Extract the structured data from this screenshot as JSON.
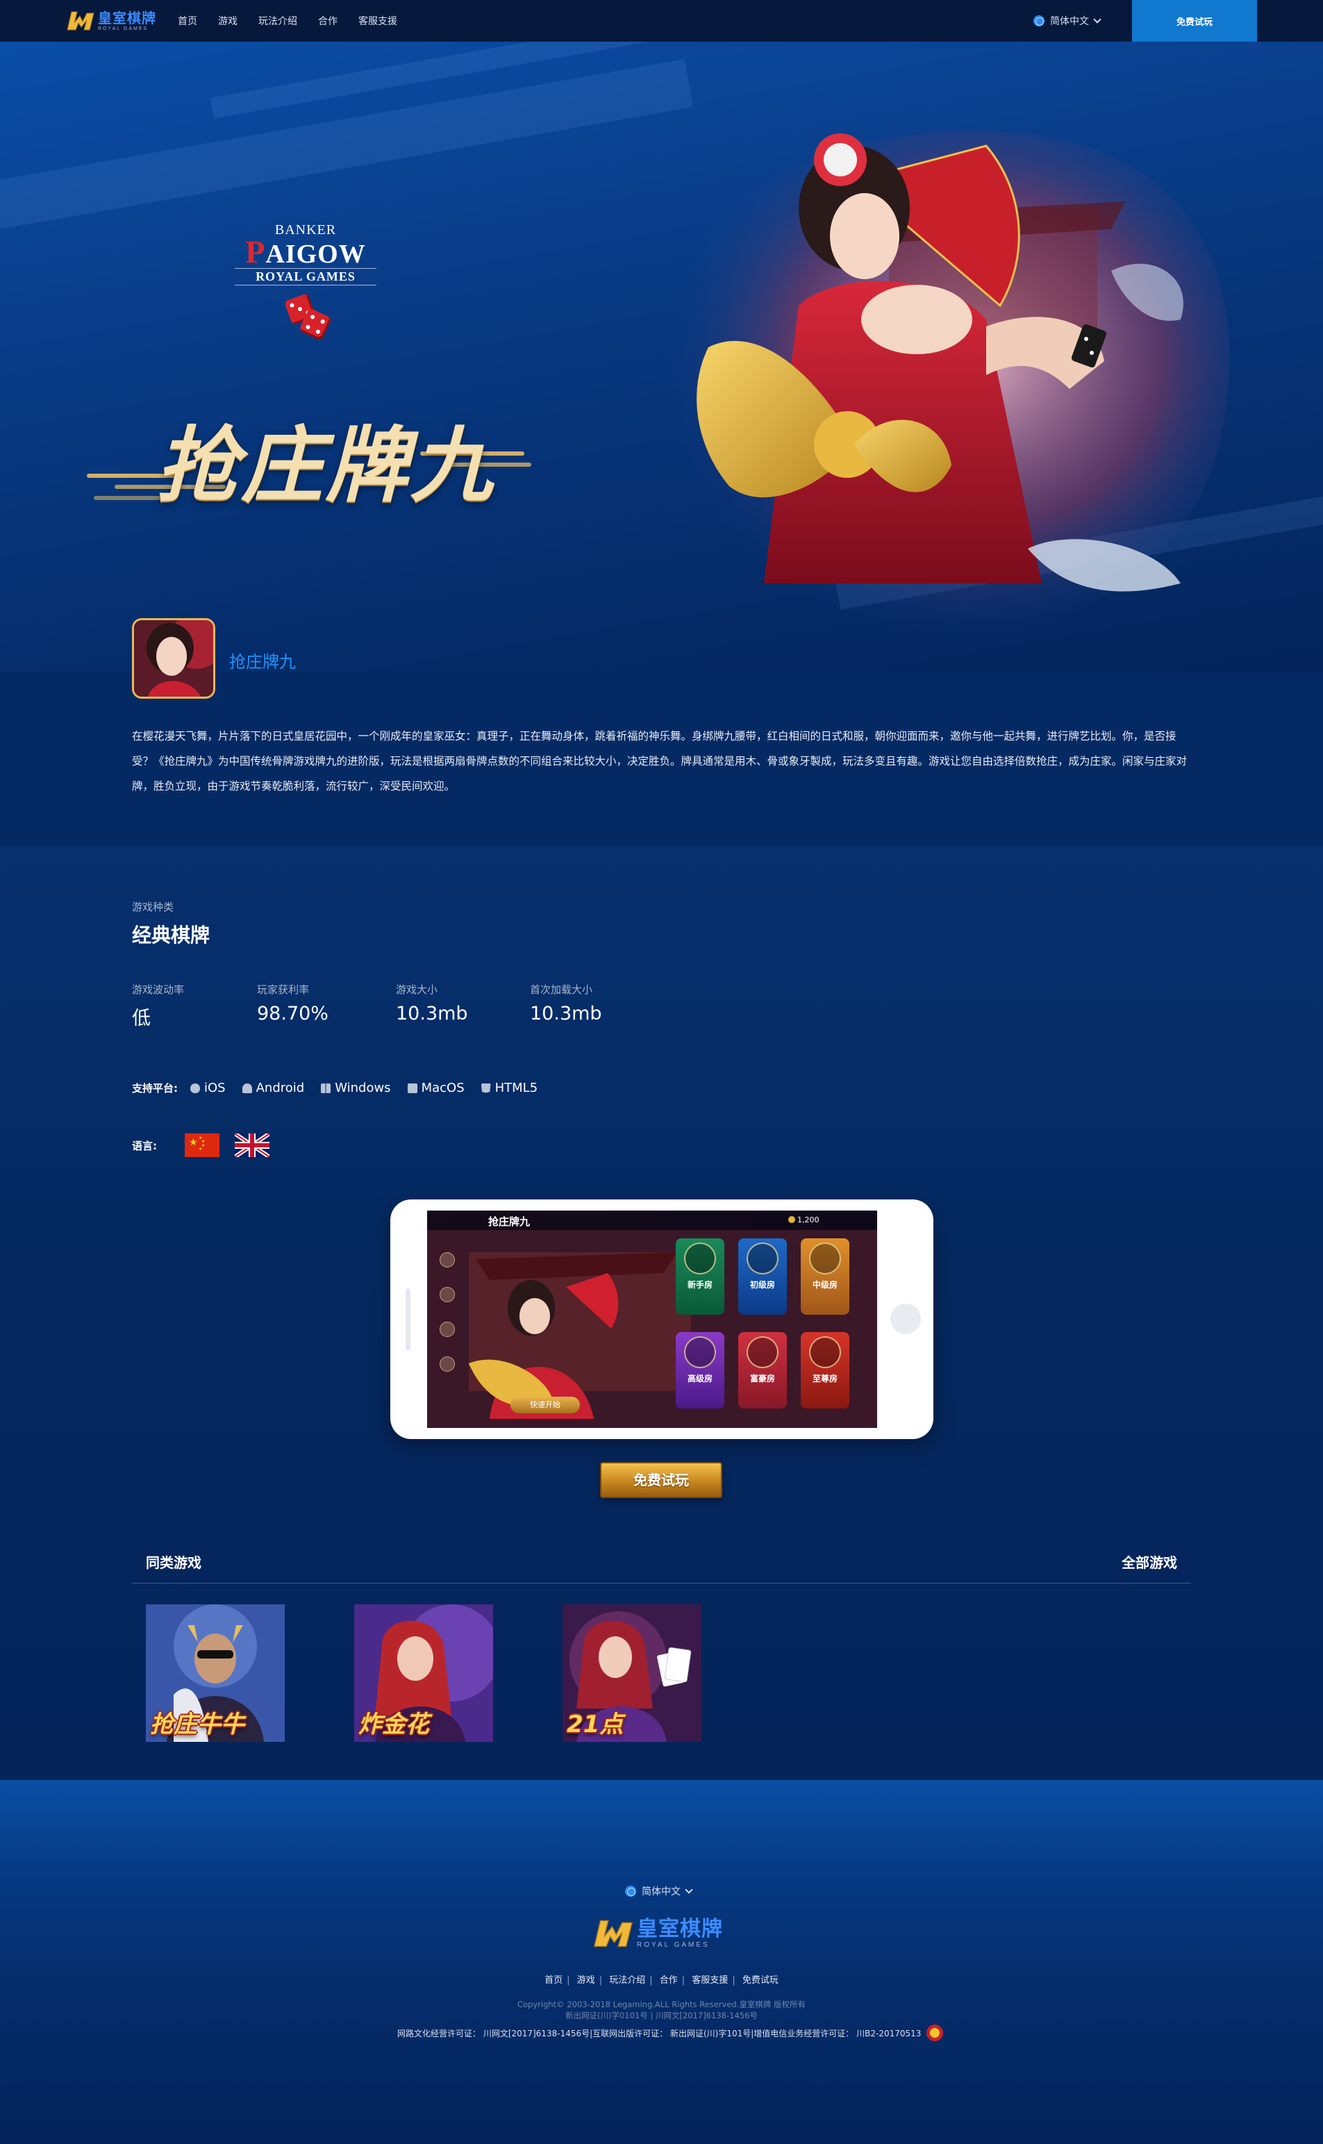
{
  "nav": {
    "logo_cn": "皇室棋牌",
    "logo_en": "ROYAL GAMES",
    "links": [
      "首页",
      "游戏",
      "玩法介绍",
      "合作",
      "客服支援"
    ],
    "language": "简体中文",
    "cta": "免费试玩"
  },
  "hero": {
    "game_logo": {
      "banker": "BANKER",
      "paigow_p": "P",
      "paigow_rest": "AIGOW",
      "royal": "ROYAL GAMES"
    },
    "title": "抢庄牌九"
  },
  "game": {
    "name": "抢庄牌九",
    "description": "在樱花漫天飞舞，片片落下的日式皇居花园中，一个刚成年的皇家巫女：真理子，正在舞动身体，跳着祈福的神乐舞。身绑牌九腰带，红白相间的日式和服，朝你迎面而来，邀你与他一起共舞，进行牌艺比划。你，是否接受？《抢庄牌九》为中国传统骨牌游戏牌九的进阶版，玩法是根据两扇骨牌点数的不同组合来比较大小，决定胜负。牌具通常是用木、骨或象牙製成，玩法多变且有趣。游戏让您自由选择倍数抢庄，成为庄家。闲家与庄家对牌，胜负立现，由于游戏节奏乾脆利落，流行较广，深受民间欢迎。"
  },
  "info": {
    "category_label": "游戏种类",
    "category_value": "经典棋牌",
    "stats": [
      {
        "label": "游戏波动率",
        "value": "低"
      },
      {
        "label": "玩家获利率",
        "value": "98.70%"
      },
      {
        "label": "游戏大小",
        "value": "10.3mb"
      },
      {
        "label": "首次加载大小",
        "value": "10.3mb"
      }
    ],
    "platform_label": "支持平台:",
    "platforms": [
      "iOS",
      "Android",
      "Windows",
      "MacOS",
      "HTML5"
    ],
    "language_label": "语言:"
  },
  "screenshot": {
    "title": "抢庄牌九",
    "coins": "1,200",
    "rooms": [
      "新手房",
      "初级房",
      "中级房",
      "高级房",
      "富豪房",
      "至尊房"
    ],
    "quick_start": "快速开始"
  },
  "trial_button": "免费试玩",
  "related": {
    "title": "同类游戏",
    "all_link": "全部游戏",
    "games": [
      "抢庄牛牛",
      "炸金花",
      "21点"
    ]
  },
  "footer": {
    "language": "简体中文",
    "logo_cn": "皇室棋牌",
    "logo_en": "ROYAL GAMES",
    "links": [
      "首页",
      "游戏",
      "玩法介绍",
      "合作",
      "客服支援",
      "免费试玩"
    ],
    "copyright": "Copyright© 2003-2018 Legaming.ALL Rights Reserved.皇室棋牌 版权所有",
    "icp": "新出网证(川)字0101号 | 川网文[2017]6138-1456号",
    "license": "网路文化经营许可证： 川网文[2017]6138-1456号|互联网出版许可证： 新出网证(川)字101号|增值电信业务经营许可证： 川B2-20170513"
  },
  "colors": {
    "nav_bg": "#06193d",
    "accent_blue": "#1078cf",
    "link_blue": "#1f93ff",
    "gold": "#e6b85a",
    "page_bg": "#04245a"
  }
}
